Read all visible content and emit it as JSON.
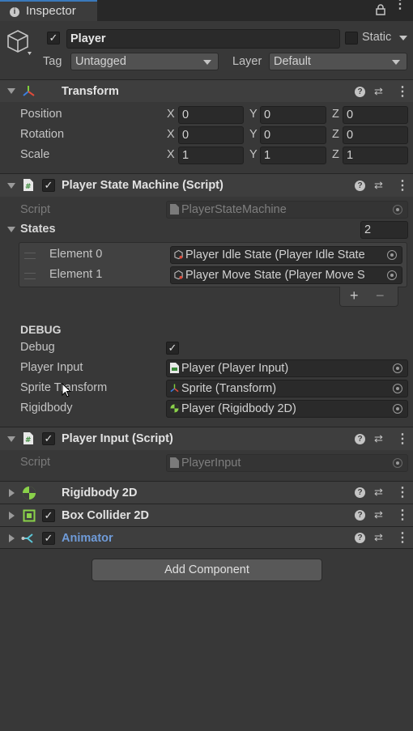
{
  "tab": {
    "title": "Inspector"
  },
  "object": {
    "name": "Player",
    "active": true,
    "static_label": "Static",
    "tag_label": "Tag",
    "tag_value": "Untagged",
    "layer_label": "Layer",
    "layer_value": "Default"
  },
  "transform": {
    "title": "Transform",
    "rows": [
      {
        "label": "Position",
        "x": "0",
        "y": "0",
        "z": "0"
      },
      {
        "label": "Rotation",
        "x": "0",
        "y": "0",
        "z": "0"
      },
      {
        "label": "Scale",
        "x": "1",
        "y": "1",
        "z": "1"
      }
    ],
    "axis_x": "X",
    "axis_y": "Y",
    "axis_z": "Z"
  },
  "psm": {
    "title": "Player State Machine (Script)",
    "script_label": "Script",
    "script_value": "PlayerStateMachine",
    "states_label": "States",
    "states_count": "2",
    "elements": [
      {
        "label": "Element 0",
        "value": "Player Idle State (Player Idle State"
      },
      {
        "label": "Element 1",
        "value": "Player Move State (Player Move S"
      }
    ],
    "add_symbol": "+",
    "remove_symbol": "−",
    "debug_header": "DEBUG",
    "debug_label": "Debug",
    "player_input_label": "Player Input",
    "player_input_value": "Player (Player Input)",
    "sprite_transform_label": "Sprite Transform",
    "sprite_transform_value": "Sprite (Transform)",
    "rigidbody_label": "Rigidbody",
    "rigidbody_value": "Player (Rigidbody 2D)"
  },
  "player_input": {
    "title": "Player Input (Script)",
    "script_label": "Script",
    "script_value": "PlayerInput"
  },
  "rigidbody2d": {
    "title": "Rigidbody 2D"
  },
  "boxcollider": {
    "title": "Box Collider 2D"
  },
  "animator": {
    "title": "Animator"
  },
  "add_component": {
    "label": "Add Component"
  },
  "colors": {
    "accent": "#3a79bb",
    "animator_title": "#6f9bd8",
    "background": "#383838",
    "header": "#3e3e3e"
  }
}
